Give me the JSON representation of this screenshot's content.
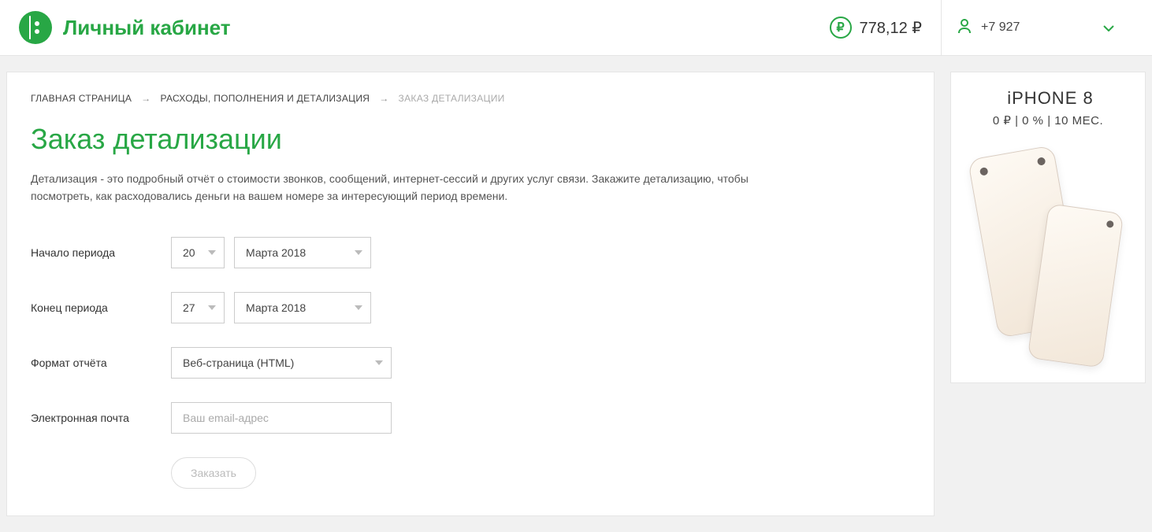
{
  "header": {
    "site_title": "Личный кабинет",
    "balance": "778,12 ₽",
    "phone": "+7 927"
  },
  "breadcrumb": {
    "home": "ГЛАВНАЯ СТРАНИЦА",
    "section": "РАСХОДЫ, ПОПОЛНЕНИЯ И ДЕТАЛИЗАЦИЯ",
    "current": "ЗАКАЗ ДЕТАЛИЗАЦИИ"
  },
  "page": {
    "title": "Заказ детализации",
    "desc": "Детализация - это подробный отчёт о стоимости звонков, сообщений, интернет-сессий и других услуг связи. Закажите детализацию, чтобы посмотреть, как расходовались деньги на вашем номере за интересующий период времени."
  },
  "form": {
    "start_label": "Начало периода",
    "start_day": "20",
    "start_month": "Марта 2018",
    "end_label": "Конец периода",
    "end_day": "27",
    "end_month": "Марта 2018",
    "format_label": "Формат отчёта",
    "format_value": "Веб-страница (HTML)",
    "email_label": "Электронная почта",
    "email_placeholder": "Ваш email-адрес",
    "submit": "Заказать"
  },
  "ad": {
    "title": "iPHONE 8",
    "sub": "0 ₽ | 0 % | 10 МЕС."
  }
}
